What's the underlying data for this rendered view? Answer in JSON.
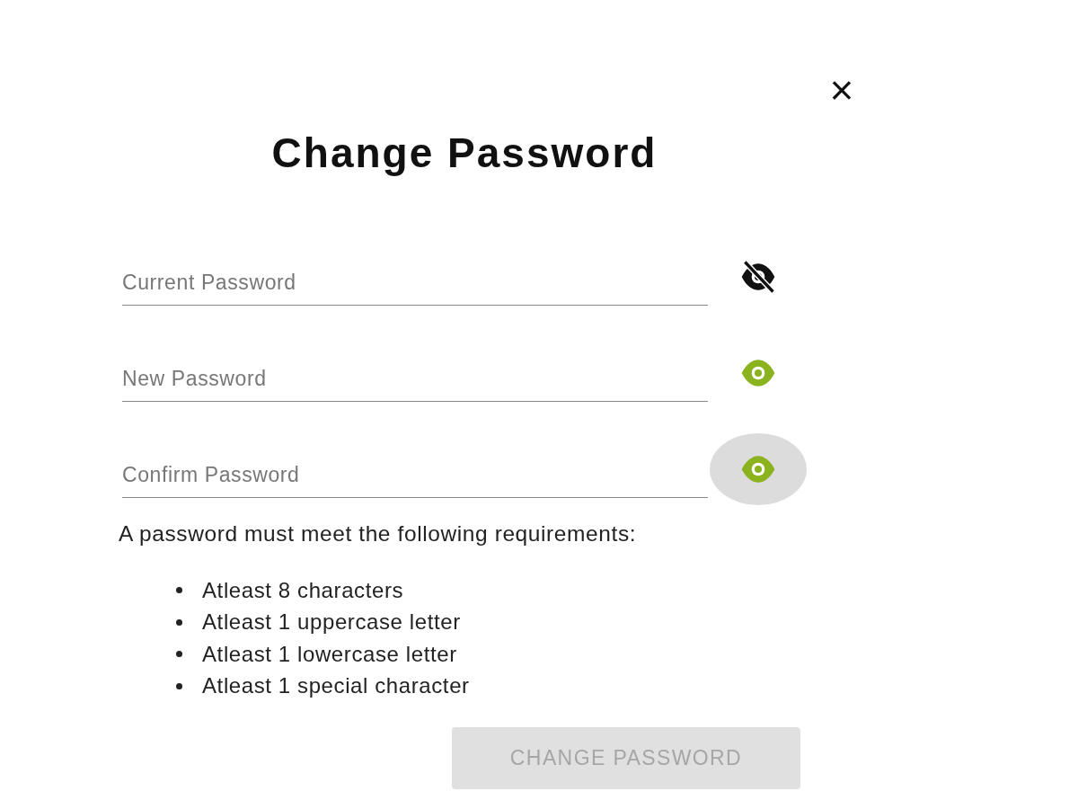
{
  "close": {
    "label": "×"
  },
  "title": "Change Password",
  "fields": [
    {
      "placeholder": "Current Password",
      "visible": false,
      "hovered": false
    },
    {
      "placeholder": "New Password",
      "visible": true,
      "hovered": false
    },
    {
      "placeholder": "Confirm Password",
      "visible": true,
      "hovered": true
    }
  ],
  "requirements_intro": "A password must meet the following requirements:",
  "requirements": [
    "Atleast 8 characters",
    "Atleast 1 uppercase letter",
    "Atleast 1 lowercase letter",
    "Atleast 1 special character"
  ],
  "submit": {
    "label": "CHANGE PASSWORD",
    "disabled": true
  }
}
